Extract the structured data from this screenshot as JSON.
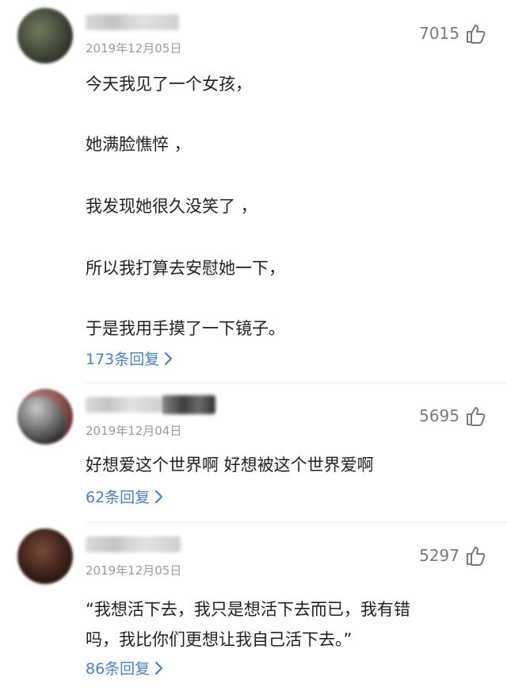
{
  "comments": [
    {
      "date": "2019年12月05日",
      "likes": "7015",
      "lines": [
        "今天我见了一个女孩，",
        "她满脸憔悴 ，",
        "我发现她很久没笑了 ，",
        "所以我打算去安慰她一下，",
        "于是我用手摸了一下镜子。"
      ],
      "replies": "173条回复"
    },
    {
      "date": "2019年12月04日",
      "likes": "5695",
      "lines": [
        "好想爱这个世界啊 好想被这个世界爱啊"
      ],
      "replies": "62条回复"
    },
    {
      "date": "2019年12月05日",
      "likes": "5297",
      "lines": [
        "“我想活下去，我只是想活下去而已，我有错",
        "吗，我比你们更想让我自己活下去。”"
      ],
      "replies": "86条回复"
    }
  ],
  "colors": {
    "reply_link": "#4a7fb8",
    "date": "#9a9a9a",
    "likes": "#7a7a7a"
  }
}
